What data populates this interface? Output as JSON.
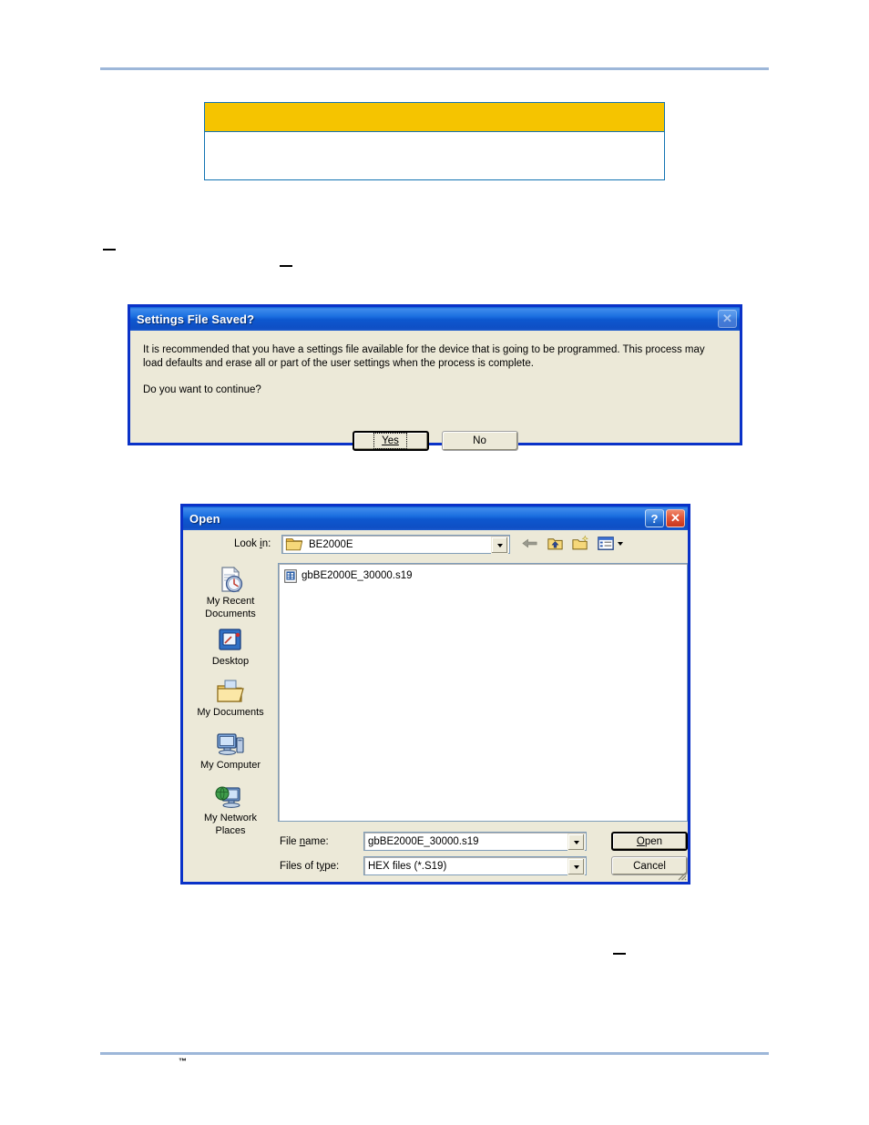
{
  "page": {
    "trademark": "™"
  },
  "note_table": {
    "header_text": "",
    "body_text": ""
  },
  "settings_dialog": {
    "title": "Settings File Saved?",
    "close_icon": "close-icon",
    "message": "It is recommended that you have a settings file available for the device that is going to be programmed.  This process may load defaults and erase all or part of the user settings when the process is complete.",
    "question": "Do you want to continue?",
    "buttons": [
      {
        "label": "Yes",
        "accel": "Y",
        "default": true,
        "focused": true
      },
      {
        "label": "No",
        "accel": "N",
        "default": false,
        "focused": false
      }
    ]
  },
  "open_dialog": {
    "title": "Open",
    "help_icon": "help-icon",
    "close_icon": "close-icon",
    "lookin": {
      "label": "Look in:",
      "accel": "i",
      "value": "BE2000E",
      "folder_icon": "open-folder-icon",
      "dropdown_icon": "chevron-down-icon"
    },
    "toolbar": [
      {
        "name": "back-icon",
        "tooltip": "Back"
      },
      {
        "name": "up-one-level-icon",
        "tooltip": "Up One Level"
      },
      {
        "name": "new-folder-icon",
        "tooltip": "Create New Folder"
      },
      {
        "name": "views-icon",
        "tooltip": "Views"
      }
    ],
    "places": [
      {
        "label_line1": "My Recent",
        "label_line2": "Documents",
        "icon": "recent-documents-icon"
      },
      {
        "label_line1": "Desktop",
        "label_line2": "",
        "icon": "desktop-icon"
      },
      {
        "label_line1": "My Documents",
        "label_line2": "",
        "icon": "my-documents-icon"
      },
      {
        "label_line1": "My Computer",
        "label_line2": "",
        "icon": "my-computer-icon"
      },
      {
        "label_line1": "My Network",
        "label_line2": "Places",
        "icon": "network-places-icon"
      }
    ],
    "files": [
      {
        "name": "gbBE2000E_30000.s19",
        "icon": "file-icon"
      }
    ],
    "filename": {
      "label": "File name:",
      "accel": "n",
      "value": "gbBE2000E_30000.s19"
    },
    "filetype": {
      "label": "Files of type:",
      "accel": "y",
      "value": "HEX files (*.S19)"
    },
    "buttons": [
      {
        "label": "Open",
        "accel": "O",
        "default": true
      },
      {
        "label": "Cancel",
        "accel": "",
        "default": false
      }
    ]
  },
  "colors": {
    "table_header": "#f5c400",
    "table_border": "#1273b2",
    "page_rule": "#9db7d9",
    "dialog_border": "#0a32c8",
    "titlebar_blue": "#1b6fe0",
    "dialog_face": "#ece9d8",
    "close_red": "#c7351b"
  }
}
